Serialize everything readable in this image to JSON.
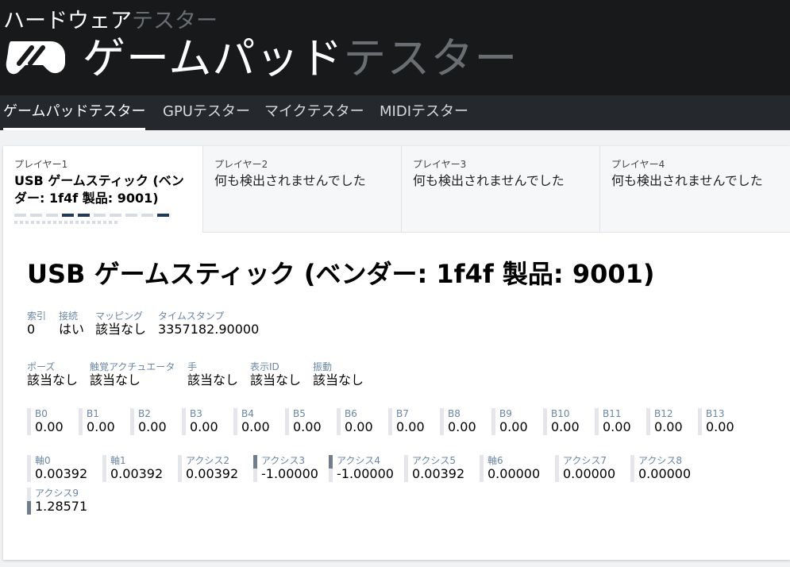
{
  "header": {
    "small_title_a": "ハードウェア",
    "small_title_b": "テスター",
    "big_title_a": "ゲームパッド",
    "big_title_b": "テスター",
    "logo_icon": "gamepad-icon"
  },
  "nav": {
    "items": [
      {
        "label": "ゲームパッドテスター",
        "active": true
      },
      {
        "label": "GPUテスター"
      },
      {
        "label": "マイクテスター"
      },
      {
        "label": "MIDIテスター"
      }
    ]
  },
  "tabs": [
    {
      "label": "プレイヤー1",
      "status": "USB ゲームスティック (ベンダー: 1f4f 製品: 9001)"
    },
    {
      "label": "プレイヤー2",
      "status": "何も検出されませんでした"
    },
    {
      "label": "プレイヤー3",
      "status": "何も検出されませんでした"
    },
    {
      "label": "プレイヤー4",
      "status": "何も検出されませんでした"
    }
  ],
  "device": {
    "title": "USB ゲームスティック (ベンダー: 1f4f 製品: 9001)",
    "info1": [
      {
        "label": "索引",
        "value": "0"
      },
      {
        "label": "接続",
        "value": "はい"
      },
      {
        "label": "マッピング",
        "value": "該当なし"
      },
      {
        "label": "タイムスタンプ",
        "value": "3357182.90000"
      }
    ],
    "info2": [
      {
        "label": "ポーズ",
        "value": "該当なし"
      },
      {
        "label": "触覚アクチュエータ",
        "value": "該当なし"
      },
      {
        "label": "手",
        "value": "該当なし"
      },
      {
        "label": "表示ID",
        "value": "該当なし"
      },
      {
        "label": "振動",
        "value": "該当なし"
      }
    ],
    "buttons": [
      {
        "label": "B0",
        "value": "0.00"
      },
      {
        "label": "B1",
        "value": "0.00"
      },
      {
        "label": "B2",
        "value": "0.00"
      },
      {
        "label": "B3",
        "value": "0.00"
      },
      {
        "label": "B4",
        "value": "0.00"
      },
      {
        "label": "B5",
        "value": "0.00"
      },
      {
        "label": "B6",
        "value": "0.00"
      },
      {
        "label": "B7",
        "value": "0.00"
      },
      {
        "label": "B8",
        "value": "0.00"
      },
      {
        "label": "B9",
        "value": "0.00"
      },
      {
        "label": "B10",
        "value": "0.00"
      },
      {
        "label": "B11",
        "value": "0.00"
      },
      {
        "label": "B12",
        "value": "0.00"
      },
      {
        "label": "B13",
        "value": "0.00"
      }
    ],
    "axes": [
      {
        "label": "軸0",
        "value": "0.00392"
      },
      {
        "label": "軸1",
        "value": "0.00392"
      },
      {
        "label": "アクシス2",
        "value": "0.00392"
      },
      {
        "label": "アクシス3",
        "value": "-1.00000"
      },
      {
        "label": "アクシス4",
        "value": "-1.00000"
      },
      {
        "label": "アクシス5",
        "value": "0.00392"
      },
      {
        "label": "軸6",
        "value": "0.00000"
      },
      {
        "label": "アクシス7",
        "value": "0.00000"
      },
      {
        "label": "アクシス8",
        "value": "0.00000"
      },
      {
        "label": "アクシス9",
        "value": "1.28571"
      }
    ]
  }
}
